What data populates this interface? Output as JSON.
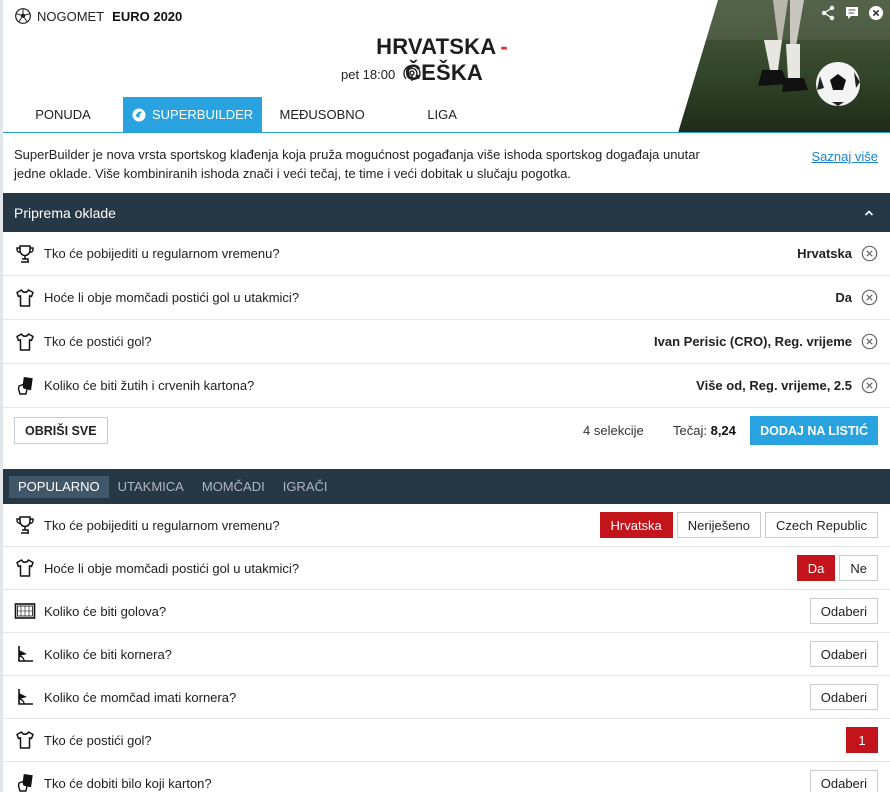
{
  "header": {
    "sport": "NOGOMET",
    "league": "EURO 2020",
    "home": "HRVATSKA",
    "separator": "-",
    "away": "ČEŠKA",
    "time": "pet 18:00"
  },
  "tabs": [
    "PONUDA",
    "SUPERBUILDER",
    "MEĐUSOBNO",
    "LIGA"
  ],
  "intro": {
    "text": "SuperBuilder je nova vrsta sportskog klađenja koja pruža mogućnost pogađanja više ishoda sportskog događaja unutar jedne oklade. Više kombiniranih ishoda znači i veći tečaj, te time i veći dobitak u slučaju pogotka.",
    "learn_more": "Saznaj više"
  },
  "builder": {
    "title": "Priprema oklade",
    "selections": [
      {
        "icon": "trophy-icon",
        "question": "Tko će pobijediti u regularnom vremenu?",
        "answer": "Hrvatska"
      },
      {
        "icon": "shirt-icon",
        "question": "Hoće li obje momčadi postići gol u utakmici?",
        "answer": "Da"
      },
      {
        "icon": "shirt-icon",
        "question": "Tko će postići gol?",
        "answer": "Ivan Perisic (CRO), Reg. vrijeme"
      },
      {
        "icon": "card-icon",
        "question": "Koliko će biti žutih i crvenih kartona?",
        "answer": "Više od, Reg. vrijeme, 2.5"
      }
    ],
    "clear_label": "OBRIŠI SVE",
    "count_label": "4 selekcije",
    "odds_label": "Tečaj:",
    "odds_value": "8,24",
    "add_label": "DODAJ NA LISTIĆ"
  },
  "markets": {
    "tabs": [
      "POPULARNO",
      "UTAKMICA",
      "MOMČADI",
      "IGRAČI"
    ],
    "rows": [
      {
        "icon": "trophy-icon",
        "question": "Tko će pobijediti u regularnom vremenu?",
        "options": [
          "Hrvatska",
          "Neriješeno",
          "Czech Republic"
        ]
      },
      {
        "icon": "shirt-icon",
        "question": "Hoće li obje momčadi postići gol u utakmici?",
        "options": [
          "Da",
          "Ne"
        ]
      },
      {
        "icon": "goal-icon",
        "question": "Koliko će biti golova?",
        "options": [
          "Odaberi"
        ]
      },
      {
        "icon": "corner-icon",
        "question": "Koliko će biti kornera?",
        "options": [
          "Odaberi"
        ]
      },
      {
        "icon": "corner-icon",
        "question": "Koliko će momčad imati kornera?",
        "options": [
          "Odaberi"
        ]
      },
      {
        "icon": "shirt-icon",
        "question": "Tko će postići gol?",
        "options": [
          "1"
        ]
      },
      {
        "icon": "card-icon",
        "question": "Tko će dobiti bilo koji karton?",
        "options": [
          "Odaberi"
        ]
      }
    ]
  },
  "colors": {
    "accent": "#29a3e0",
    "dark": "#263746",
    "selected": "#c4141b"
  }
}
